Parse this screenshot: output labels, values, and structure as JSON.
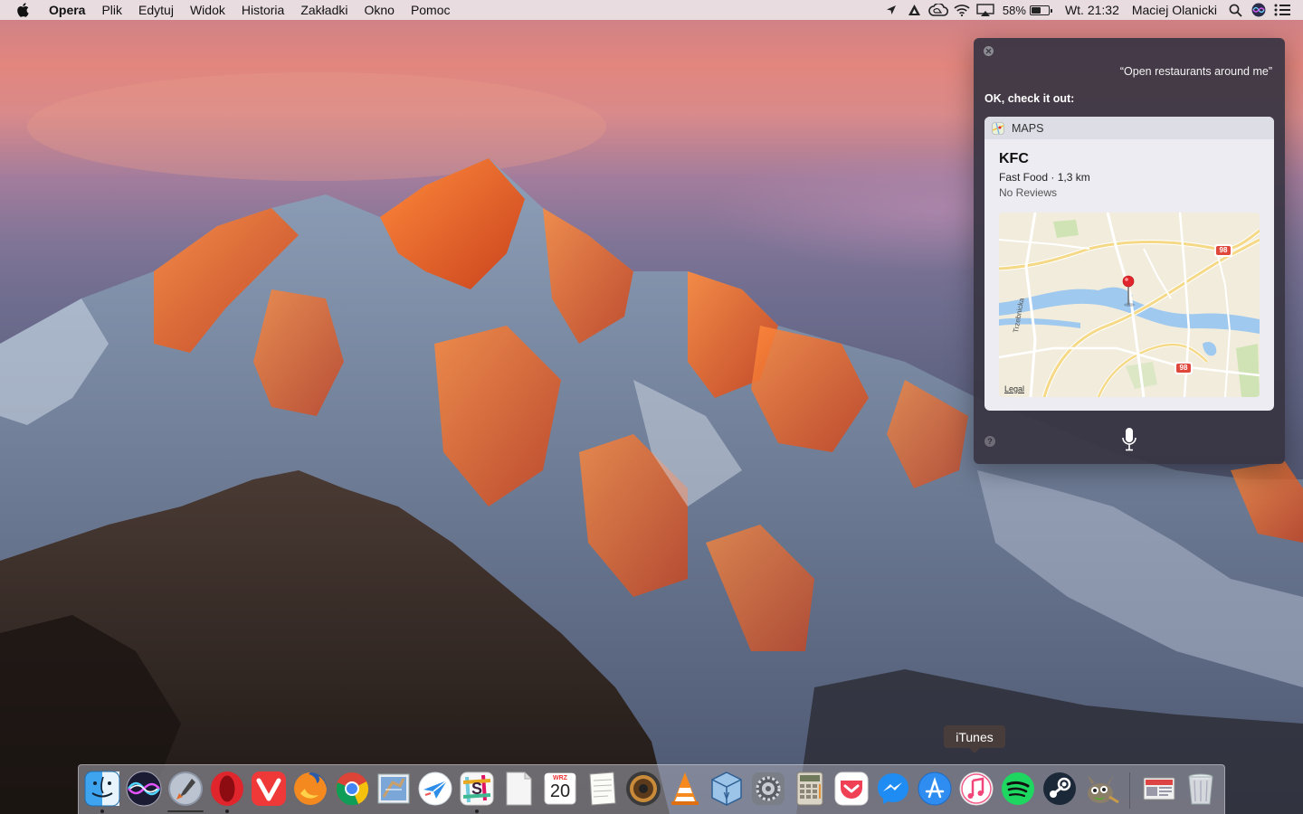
{
  "menubar": {
    "apple_icon": "apple-logo-icon",
    "app_name": "Opera",
    "menus": [
      "Plik",
      "Edytuj",
      "Widok",
      "Historia",
      "Zakładki",
      "Okno",
      "Pomoc"
    ],
    "status_icons": [
      "location-arrow-icon",
      "notification-triangle-icon",
      "creative-cloud-icon",
      "wifi-icon",
      "airplay-icon"
    ],
    "battery_percent": "58%",
    "battery_level": 0.58,
    "clock": "Wt. 21:32",
    "user_name": "Maciej Olanicki",
    "search_icon": "spotlight-search-icon",
    "siri_icon": "siri-icon",
    "notification_icon": "notification-center-icon"
  },
  "siri": {
    "query": "“Open restaurants around me”",
    "reply": "OK, check it out:",
    "help_label": "?",
    "card": {
      "source": "MAPS",
      "place_name": "KFC",
      "category_distance": "Fast Food · 1,3 km",
      "reviews": "No Reviews",
      "map": {
        "street_label": "Trzebnicka",
        "road_badges": [
          "98",
          "98"
        ],
        "legal": "Legal"
      }
    }
  },
  "dock": {
    "tooltip": "iTunes",
    "calendar_month": "WRZ",
    "calendar_day": "20",
    "apps": [
      {
        "name": "Finder",
        "icon": "finder-icon",
        "running": true
      },
      {
        "name": "Siri",
        "icon": "siri-icon",
        "running": false
      },
      {
        "name": "Launchpad",
        "icon": "launchpad-icon",
        "running": false
      },
      {
        "name": "Opera",
        "icon": "opera-icon",
        "running": true
      },
      {
        "name": "Vivaldi",
        "icon": "vivaldi-icon",
        "running": false
      },
      {
        "name": "Firefox",
        "icon": "firefox-icon",
        "running": false
      },
      {
        "name": "Chrome",
        "icon": "chrome-icon",
        "running": false
      },
      {
        "name": "Mail",
        "icon": "mail-icon",
        "running": false
      },
      {
        "name": "Airmail",
        "icon": "airmail-icon",
        "running": false
      },
      {
        "name": "Slack",
        "icon": "slack-icon",
        "running": true
      },
      {
        "name": "TextEdit",
        "icon": "document-icon",
        "running": false
      },
      {
        "name": "Calendar",
        "icon": "calendar-icon",
        "running": false
      },
      {
        "name": "Notes",
        "icon": "notes-icon",
        "running": false
      },
      {
        "name": "Vox",
        "icon": "speaker-icon",
        "running": false
      },
      {
        "name": "VLC",
        "icon": "vlc-icon",
        "running": false
      },
      {
        "name": "VirtualBox",
        "icon": "virtualbox-icon",
        "running": false
      },
      {
        "name": "System Preferences",
        "icon": "gear-icon",
        "running": false
      },
      {
        "name": "Calculator",
        "icon": "calculator-icon",
        "running": false
      },
      {
        "name": "Pocket",
        "icon": "pocket-icon",
        "running": false
      },
      {
        "name": "Messenger",
        "icon": "messenger-icon",
        "running": false
      },
      {
        "name": "App Store",
        "icon": "app-store-icon",
        "running": false
      },
      {
        "name": "iTunes",
        "icon": "itunes-icon",
        "running": false
      },
      {
        "name": "Spotify",
        "icon": "spotify-icon",
        "running": false
      },
      {
        "name": "Steam",
        "icon": "steam-icon",
        "running": false
      },
      {
        "name": "GIMP",
        "icon": "gimp-icon",
        "running": false
      },
      {
        "name": "Downloads",
        "icon": "downloads-stack-icon",
        "running": false
      },
      {
        "name": "Trash",
        "icon": "trash-icon",
        "running": false
      }
    ]
  },
  "colors": {
    "siri_panel": "#37344a",
    "card_bg": "#ececf2",
    "map_pin": "#e0262c",
    "road_badge": "#e0473b",
    "opera_red": "#e0262c"
  }
}
